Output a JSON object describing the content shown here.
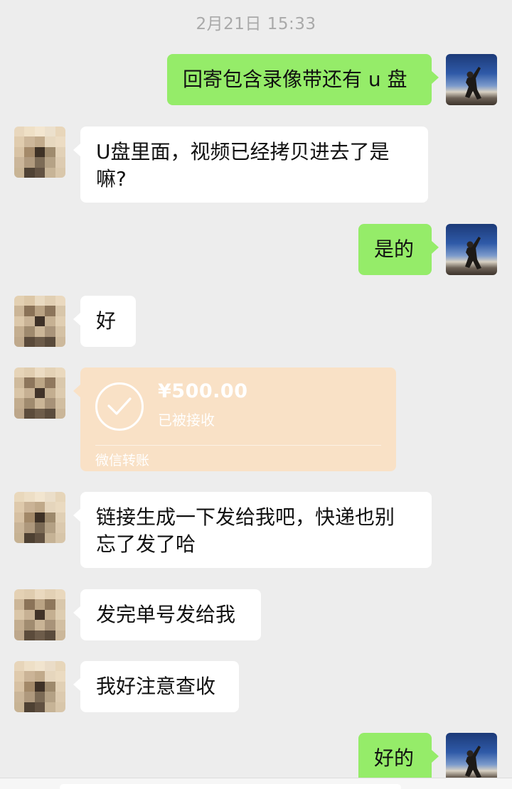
{
  "chat": {
    "timestamp": "2月21日 15:33",
    "messages": [
      {
        "side": "out",
        "text": "回寄包含录像带还有 u 盘"
      },
      {
        "side": "in",
        "text_lines": [
          "U盘里面，视频已经拷贝进去了是",
          "嘛?"
        ]
      },
      {
        "side": "out",
        "text": "是的"
      },
      {
        "side": "in",
        "text": "好"
      },
      {
        "side": "in",
        "type": "transfer",
        "amount": "¥500.00",
        "status": "已被接收",
        "label": "微信转账",
        "icon": "checkmark-icon"
      },
      {
        "side": "in",
        "text_lines": [
          "链接生成一下发给我吧，快递也别",
          "忘了发了哈"
        ]
      },
      {
        "side": "in",
        "text": "发完单号发给我"
      },
      {
        "side": "in",
        "text": "我好注意查收"
      },
      {
        "side": "out",
        "text": "好的"
      }
    ]
  },
  "colors": {
    "background": "#ededed",
    "bubble_out": "#95ec69",
    "bubble_in": "#ffffff",
    "transfer_card": "#f9e1c6",
    "timestamp_text": "#a9a9a9"
  }
}
